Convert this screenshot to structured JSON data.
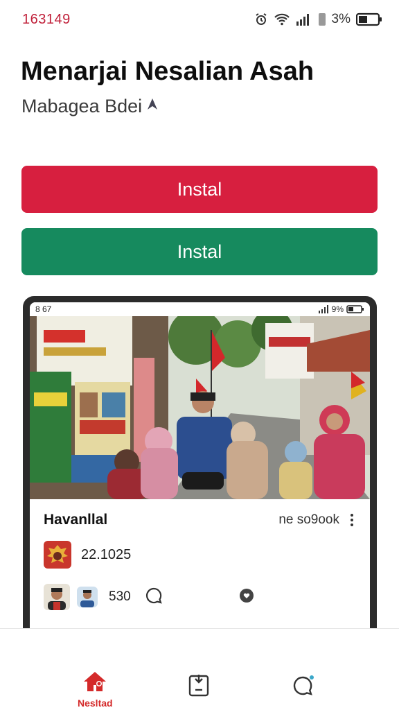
{
  "status_bar": {
    "time": "163149",
    "battery_percent": "3%",
    "icons": [
      "alarm-icon",
      "wifi-icon",
      "signal-icon",
      "sim-icon",
      "battery-icon"
    ]
  },
  "header": {
    "title": "Menarjai Nesalian Asah",
    "subtitle": "Mabagea Bdei"
  },
  "buttons": {
    "primary_label": "Instal",
    "secondary_label": "Instal"
  },
  "card": {
    "inner_status": {
      "time": "8 67",
      "battery": "9%"
    },
    "name": "Havanllal",
    "meta": "ne so9ook",
    "stat_value": "22.1025",
    "comments_count": "530"
  },
  "bottom_nav": {
    "home_label": "Nesltad",
    "icons": [
      "home-icon",
      "document-icon",
      "chat-icon"
    ]
  },
  "colors": {
    "primary_red": "#d71f3f",
    "primary_green": "#168a5e",
    "status_time": "#c0203a"
  }
}
